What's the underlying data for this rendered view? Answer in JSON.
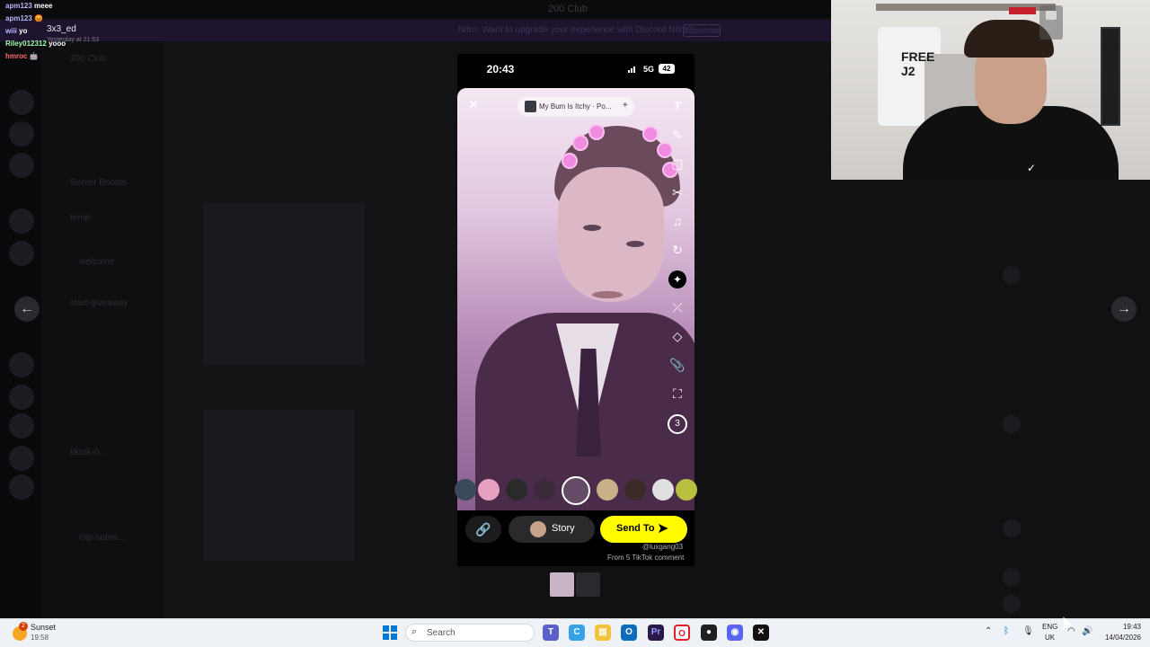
{
  "chat": {
    "lines": [
      {
        "user": "apm123",
        "msg": "meee"
      },
      {
        "user": "apm123",
        "msg": "😡"
      },
      {
        "user": "wiii",
        "msg": "yo"
      },
      {
        "user": "Riley012312",
        "msg": "yooo"
      },
      {
        "user": "hmroc",
        "msg": "🤖"
      }
    ],
    "preview_name": "3x3_ed",
    "preview_time": "Yesterday at 21:53"
  },
  "discord": {
    "window_title": "200 Club",
    "server_name": "200 Club",
    "banner_text": "Nitro: Want to upgrade your experience with Discord Nitro?",
    "banner_button": "Subscribe",
    "channels": [
      "Server Boosts",
      "temp",
      "welcome",
      "start-giveaway",
      "tiktok-0...",
      "clip-subm..."
    ]
  },
  "webcam": {
    "jersey_text": "FREE\nJ2"
  },
  "phone": {
    "time": "20:43",
    "network": "5G",
    "battery": "42"
  },
  "snap": {
    "close_icon": "close-icon",
    "song_title": "My Bum Is Itchy · Po...",
    "song_add": "+",
    "tools": [
      "T",
      "✎",
      "▢",
      "✂",
      "♫",
      "↻",
      "✦",
      "⤫",
      "◇",
      "📎",
      "⛶"
    ],
    "timer_label": "3",
    "link_icon": "link-icon",
    "story_label": "Story",
    "send_label": "Send To",
    "watermark_line1": "@luxgang03",
    "watermark_line2": "From 5 TikTok comment"
  },
  "taskbar": {
    "weather_label": "Sunset",
    "weather_time": "19:58",
    "weather_badge": "2",
    "search_placeholder": "Search",
    "tray_lang_1": "ENG",
    "tray_lang_2": "UK",
    "clock_time": "19:43",
    "clock_date": "14/04/2026"
  },
  "colors": {
    "snap_yellow": "#fffc00",
    "taskbar_bg": "#eef1f6",
    "windows_blue": "#0078d4"
  }
}
